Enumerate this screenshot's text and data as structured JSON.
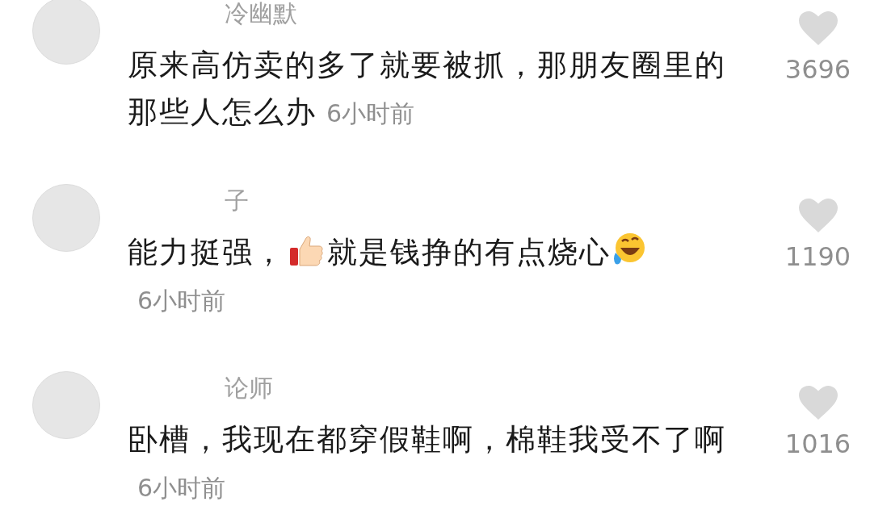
{
  "comments": [
    {
      "username": "冷幽默",
      "parts": [
        {
          "kind": "text",
          "text": "原来高仿卖的多了就要被抓，那朋友圈里的"
        },
        {
          "kind": "break"
        },
        {
          "kind": "text",
          "text": "那些人怎么办"
        },
        {
          "kind": "time",
          "text": "6小时前"
        }
      ],
      "likes": "3696",
      "liked": false
    },
    {
      "username": "子",
      "parts": [
        {
          "kind": "text",
          "text": "能力挺强，"
        },
        {
          "kind": "thumbs_up"
        },
        {
          "kind": "text",
          "text": "就是钱挣的有点烧心"
        },
        {
          "kind": "laughing_tears"
        },
        {
          "kind": "break"
        },
        {
          "kind": "time",
          "text": "6小时前"
        }
      ],
      "likes": "1190",
      "liked": false
    },
    {
      "username": "论师",
      "parts": [
        {
          "kind": "text",
          "text": "卧槽，我现在都穿假鞋啊，棉鞋我受不了啊"
        },
        {
          "kind": "break"
        },
        {
          "kind": "time",
          "text": "6小时前"
        }
      ],
      "likes": "1016",
      "liked": false
    }
  ]
}
